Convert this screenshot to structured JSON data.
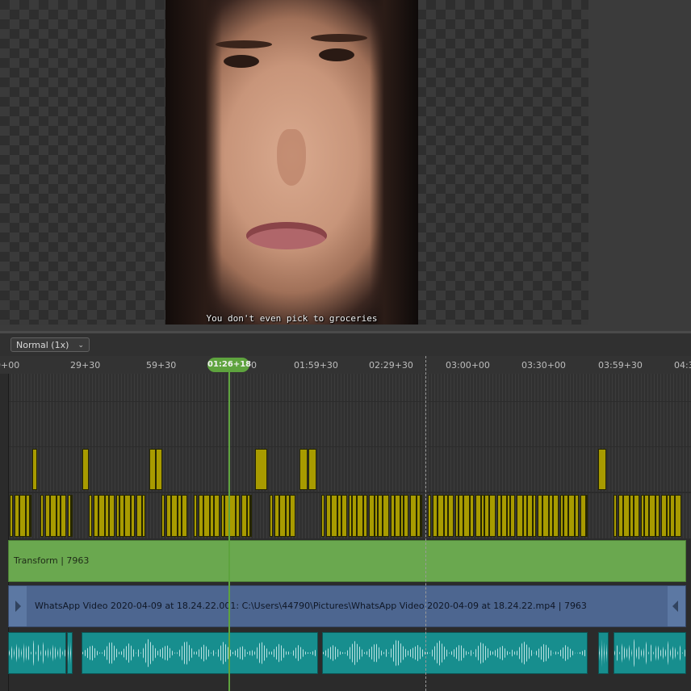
{
  "preview": {
    "subtitle": "You don't even pick to groceries"
  },
  "toolbar": {
    "speed_label": "Normal (1x)",
    "speed_chevron_icon": "chevron-down-icon"
  },
  "timeline": {
    "ruler_ticks": [
      "0+00",
      "29+30",
      "59+30",
      "0",
      "01:59+30",
      "02:29+30",
      "03:00+00",
      "03:30+00",
      "03:59+30",
      "04:3"
    ],
    "playhead_time": "01:26+18",
    "colors": {
      "playhead": "#5ea33e",
      "keyframe_bars": "#a89b00",
      "transform_clip": "#6aa84f",
      "video_clip": "#4d6690",
      "audio_clip": "#178e8e"
    }
  },
  "clips": {
    "transform": {
      "label": "Transform | 7963"
    },
    "video": {
      "label": "WhatsApp Video 2020-04-09 at 18.24.22.001: C:\\Users\\44790\\Pictures\\WhatsApp Video 2020-04-09 at 18.24.22.mp4 | 7963"
    }
  }
}
